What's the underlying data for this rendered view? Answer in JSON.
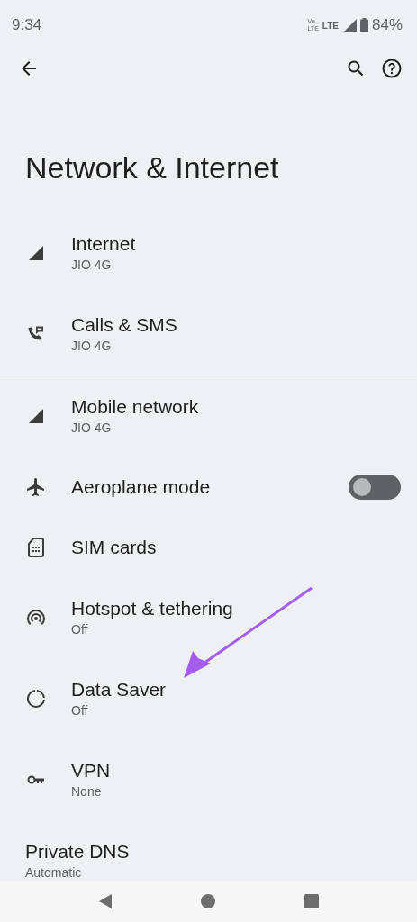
{
  "status_bar": {
    "time": "9:34",
    "volte": [
      "Vo",
      "LTE"
    ],
    "network": "LTE",
    "battery": "84%"
  },
  "title": "Network & Internet",
  "sections": [
    {
      "items": [
        {
          "kind": "link",
          "title": "Internet",
          "subtitle": "JIO 4G"
        },
        {
          "kind": "link",
          "title": "Calls & SMS",
          "subtitle": "JIO 4G"
        }
      ]
    },
    {
      "items": [
        {
          "kind": "link",
          "title": "Mobile network",
          "subtitle": "JIO 4G"
        },
        {
          "kind": "switch",
          "title": "Aeroplane mode",
          "on": false
        },
        {
          "kind": "link",
          "title": "SIM cards"
        },
        {
          "kind": "link",
          "title": "Hotspot & tethering",
          "subtitle": "Off"
        },
        {
          "kind": "link",
          "title": "Data Saver",
          "subtitle": "Off"
        },
        {
          "kind": "link",
          "title": "VPN",
          "subtitle": "None"
        },
        {
          "kind": "text",
          "title": "Private DNS",
          "subtitle": "Automatic"
        }
      ]
    }
  ]
}
